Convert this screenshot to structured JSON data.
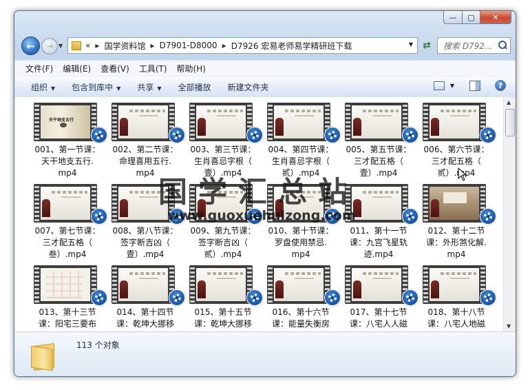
{
  "window": {
    "caption_buttons": {
      "minimize": "—",
      "maximize": "▢",
      "close": "✕"
    }
  },
  "nav": {
    "back_icon": "arrow-left-icon",
    "forward_icon": "arrow-right-icon",
    "address": {
      "lead": "«",
      "crumbs": [
        "国学资料馆",
        "D7901-D8000",
        "D7926 宏易老师易学精研班下载"
      ]
    },
    "search_placeholder": "搜索 D792..."
  },
  "menu": [
    "文件(F)",
    "编辑(E)",
    "查看(V)",
    "工具(T)",
    "帮助(H)"
  ],
  "toolbar": {
    "organize": "组织",
    "include_in_library": "包含到库中",
    "share": "共享",
    "play_all": "全部播放",
    "new_folder": "新建文件夹"
  },
  "files": [
    {
      "name": "001、第一节课：\n天干地支五行.\nmp4",
      "thumb": "scroll",
      "thumb_text": "天干地支五行"
    },
    {
      "name": "002、第二节课：\n命理喜用五行.\nmp4",
      "thumb": "slide"
    },
    {
      "name": "003、第三节课：\n生肖喜忌字根（\n壹）.mp4",
      "thumb": "slide"
    },
    {
      "name": "004、第四节课：\n生肖喜忌字根（\n贰）.mp4",
      "thumb": "slide"
    },
    {
      "name": "005、第五节课：\n三才配五格（\n壹）.mp4",
      "thumb": "slide"
    },
    {
      "name": "006、第六节课：\n三才配五格（\n贰）.mp4",
      "thumb": "slide"
    },
    {
      "name": "007、第七节课：\n三才配五格（\n叁）.mp4",
      "thumb": "slide"
    },
    {
      "name": "008、第八节课：\n签字断吉凶（\n壹）.mp4",
      "thumb": "slide"
    },
    {
      "name": "009、第九节课：\n签字断吉凶（\n贰）.mp4",
      "thumb": "slide"
    },
    {
      "name": "010、第十节课：\n罗盘使用禁忌.\nmp4",
      "thumb": "slide"
    },
    {
      "name": "011、第十一节\n课：九宫飞星轨\n迹.mp4",
      "thumb": "slide"
    },
    {
      "name": "012、第十二节\n课：外形煞化解.\nmp4",
      "thumb": "hall"
    },
    {
      "name": "013、第十三节\n课：阳宅三要布",
      "thumb": "chart"
    },
    {
      "name": "014、第十四节\n课：乾坤大挪移",
      "thumb": "slide"
    },
    {
      "name": "015、第十五节\n课：乾坤大挪移",
      "thumb": "slide"
    },
    {
      "name": "016、第十六节\n课：能量失衡房",
      "thumb": "slide"
    },
    {
      "name": "017、第十七节\n课：八宅人人磁",
      "thumb": "slide"
    },
    {
      "name": "018、第十八节\n课：八宅人地磁",
      "thumb": "slide"
    }
  ],
  "watermark": {
    "title": "国学汇总站",
    "url": "www.guoxuehuizong.com"
  },
  "details": {
    "count": "113 个对象"
  },
  "colors": {
    "accent": "#2a6cc0",
    "badge": "#0b3f8c",
    "frame_bg": "#c7d9ee"
  }
}
